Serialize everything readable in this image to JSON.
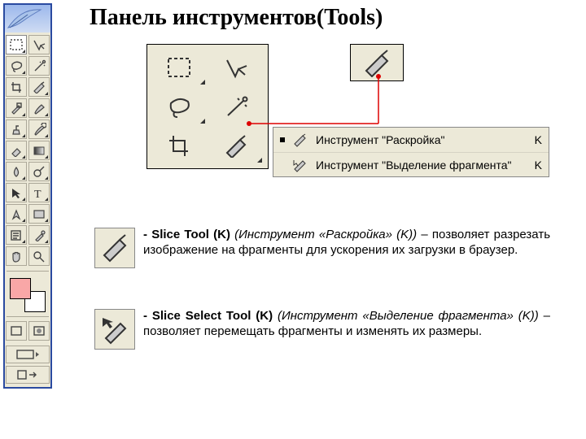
{
  "title_ru": "Панель инструментов",
  "title_en": "(Tools)",
  "flyout": {
    "items": [
      {
        "label": "Инструмент \"Раскройка\"",
        "key": "K"
      },
      {
        "label": "Инструмент \"Выделение фрагмента\"",
        "key": "K"
      }
    ]
  },
  "descriptions": [
    {
      "lead": "- Slice Tool (K)",
      "paren": " (Инструмент «Раскройка» (K))",
      "tail": " – позволяет разрезать изображение на фрагменты для ускорения их загрузки в браузер."
    },
    {
      "lead": "- Slice Select Tool (K)",
      "paren": " (Инструмент «Выделение фрагмента» (K))",
      "tail": " – позволяет перемещать фрагменты и изменять их размеры."
    }
  ],
  "swatches": {
    "fg": "#f9a7a7",
    "bg": "#ffffff"
  },
  "icons": {
    "marquee": "rectangular-marquee-icon",
    "move": "move-icon",
    "lasso": "lasso-icon",
    "wand": "magic-wand-icon",
    "crop": "crop-icon",
    "slice": "slice-icon",
    "brush": "brush-icon",
    "healing": "healing-brush-icon",
    "stamp": "clone-stamp-icon",
    "history": "history-brush-icon",
    "eraser": "eraser-icon",
    "gradient": "gradient-icon",
    "blur": "blur-icon",
    "dodge": "dodge-icon",
    "path": "path-select-icon",
    "type": "type-icon",
    "pen": "pen-icon",
    "shape": "shape-icon",
    "notes": "notes-icon",
    "eyedrop": "eyedropper-icon",
    "hand": "hand-icon",
    "zoom": "zoom-icon",
    "sliceSelect": "slice-select-icon"
  }
}
